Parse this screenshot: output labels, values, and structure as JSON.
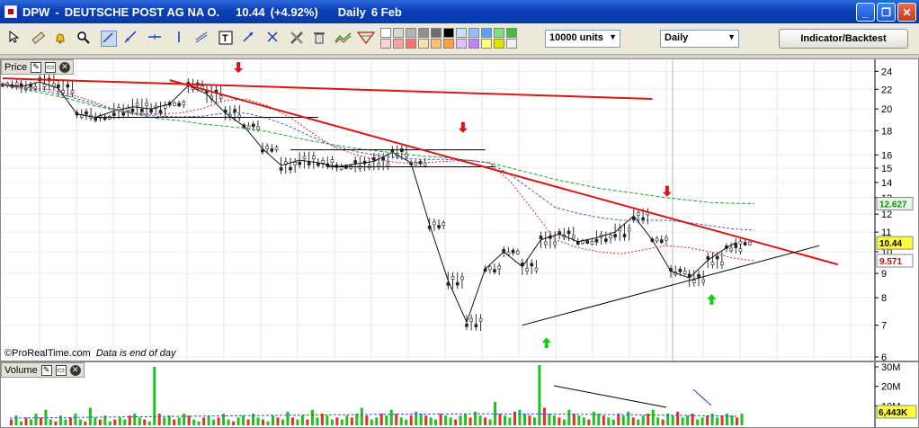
{
  "window": {
    "ticker": "DPW",
    "separator": "-",
    "company": "DEUTSCHE POST AG NA O.",
    "last": "10.44",
    "change": "(+4.92%)",
    "interval": "Daily",
    "date": "6 Feb",
    "buttons": {
      "minimize": "_",
      "maximize": "❐",
      "close": "✕"
    }
  },
  "toolbar": {
    "tools": [
      "pointer-icon",
      "ruler-icon",
      "alarm-bell-icon",
      "zoom-icon",
      "line-icon",
      "ray-icon",
      "horizontal-line-icon",
      "vertical-line-icon",
      "text-icon",
      "arrow-icon",
      "tools-icon",
      "trash-icon",
      "channel-icon",
      "fibonacci-icon"
    ],
    "palette_colors": [
      "#ffffff",
      "#d8d8d8",
      "#b4b4b4",
      "#909090",
      "#6c6c6c",
      "#000000",
      "#c8e0ff",
      "#90c0ff",
      "#58a0ff",
      "#80e080",
      "#40c040",
      "#ffd0d0",
      "#ffa0a0",
      "#ff7070",
      "#ffe0b0",
      "#ffc070",
      "#ffa040",
      "#e0c0ff",
      "#c080ff",
      "#ffff80",
      "#e0e000",
      "#f0f0f0"
    ],
    "quantity": "10000 units",
    "interval_select": "Daily",
    "indicator_button": "Indicator/Backtest"
  },
  "price_panel": {
    "title": "Price",
    "credit": "©ProRealTime.com",
    "credit_note": "Data is end of day",
    "last_tag": "10.44",
    "ma_long_tag": "12.627",
    "ma_mid_tag": "9.571",
    "y_ticks": [
      "24",
      "22",
      "20",
      "18",
      "16",
      "15",
      "14",
      "13",
      "12",
      "11",
      "10",
      "9",
      "8",
      "7",
      "6"
    ]
  },
  "volume_panel": {
    "title": "Volume",
    "y_ticks": [
      "30M",
      "20M",
      "10M"
    ],
    "last_tag": "6,443K"
  },
  "chart_data": [
    {
      "type": "line",
      "title": "Price",
      "yscale": "log",
      "ylim": [
        6,
        25
      ],
      "x": [
        0,
        10,
        20,
        30,
        40,
        50,
        60,
        70,
        80,
        90,
        100,
        110,
        120,
        130,
        140,
        150,
        160,
        170,
        180,
        190,
        200,
        210,
        220,
        230,
        240,
        250,
        260,
        270,
        280,
        290,
        300,
        310,
        320
      ],
      "series": [
        {
          "values": [
            22.5,
            22.3,
            22.8,
            22.1,
            19.5,
            19.2,
            19.8,
            20.2,
            20.0,
            20.5,
            22.4,
            21.5,
            19.6,
            18.4,
            16.5,
            15.2,
            15.6,
            15.4,
            15.1,
            15.3,
            15.5,
            16.2,
            15.4,
            11.4,
            8.7,
            7.1,
            9.2,
            10.0,
            9.3,
            10.6,
            10.9,
            10.5,
            10.7
          ]
        },
        {
          "values": [
            22.5,
            22.3,
            22.8,
            22.1,
            19.5,
            19.2,
            19.8,
            20.2,
            20.0,
            20.5,
            22.4,
            21.5,
            19.6,
            18.4,
            16.5,
            15.2,
            15.6,
            15.4,
            15.1,
            15.3,
            15.5,
            16.2,
            15.4,
            11.4,
            8.7,
            7.1,
            9.2,
            10.0,
            9.3,
            10.6,
            10.9,
            10.5,
            10.7
          ]
        }
      ],
      "x_extra": [
        330,
        340,
        350,
        360,
        370,
        380,
        390,
        395
      ],
      "values_extra": [
        11.0,
        11.9,
        10.6,
        9.1,
        8.8,
        9.6,
        10.2,
        10.44
      ],
      "ma_long": [
        22.5,
        22.0,
        21.5,
        21.0,
        20.4,
        19.9,
        19.5,
        19.1,
        18.9,
        18.6,
        18.4,
        18.2,
        17.9,
        17.5,
        17.1,
        16.8,
        16.5,
        16.3,
        16.1,
        15.9,
        15.8,
        15.6,
        15.4,
        15.0,
        14.6,
        14.2,
        13.9,
        13.6,
        13.4,
        13.2,
        13.0,
        12.85,
        12.7,
        12.65,
        12.63
      ],
      "ma_mid": [
        22.4,
        22.2,
        22.0,
        21.5,
        20.8,
        20.0,
        19.6,
        19.5,
        19.6,
        20.0,
        20.8,
        21.0,
        20.3,
        19.2,
        17.8,
        16.6,
        16.0,
        15.6,
        15.4,
        15.4,
        15.5,
        15.6,
        15.4,
        14.0,
        12.2,
        10.6,
        10.2,
        10.0,
        9.9,
        10.1,
        10.3,
        10.2,
        10.0,
        9.7,
        9.57
      ],
      "trendlines": [
        {
          "from": [
            0,
            23.2
          ],
          "to": [
            350,
            21.0
          ]
        },
        {
          "from": [
            90,
            23.0
          ],
          "to": [
            450,
            9.4
          ]
        },
        {
          "from": [
            280,
            7.0
          ],
          "to": [
            440,
            10.3
          ]
        }
      ],
      "annotations": {
        "red_arrows_at": [
          127,
          248,
          358
        ],
        "green_arrows_at": [
          293,
          382
        ]
      },
      "legend": "none",
      "grid": true
    },
    {
      "type": "bar",
      "title": "Volume",
      "ylim": [
        0,
        30
      ],
      "y_unit": "M",
      "values": [
        3,
        5,
        2,
        4,
        3,
        6,
        4,
        8,
        3,
        2,
        5,
        3,
        4,
        6,
        3,
        2,
        9,
        4,
        3,
        5,
        2,
        3,
        4,
        3,
        5,
        6,
        4,
        3,
        2,
        30,
        6,
        4,
        5,
        3,
        4,
        6,
        5,
        3,
        2,
        4,
        5,
        3,
        4,
        6,
        3,
        2,
        4,
        5,
        3,
        6,
        4,
        3,
        2,
        5,
        4,
        3,
        7,
        4,
        3,
        5,
        3,
        8,
        4,
        6,
        5,
        3,
        4,
        3,
        5,
        4,
        6,
        9,
        5,
        3,
        4,
        6,
        5,
        8,
        6,
        4,
        3,
        5,
        7,
        6,
        5,
        4,
        3,
        6,
        5,
        4,
        3,
        5,
        6,
        4,
        7,
        5,
        4,
        3,
        12,
        6,
        5,
        4,
        7,
        8,
        6,
        5,
        4,
        31,
        9,
        6,
        5,
        4,
        3,
        8,
        6,
        5,
        4,
        3,
        7,
        6,
        5,
        4,
        3,
        6,
        5,
        7,
        4,
        3,
        5,
        6,
        8,
        4,
        3,
        6,
        5,
        7,
        4,
        5,
        6,
        3,
        4,
        5,
        6,
        4,
        5,
        6,
        5,
        4,
        6
      ]
    }
  ]
}
